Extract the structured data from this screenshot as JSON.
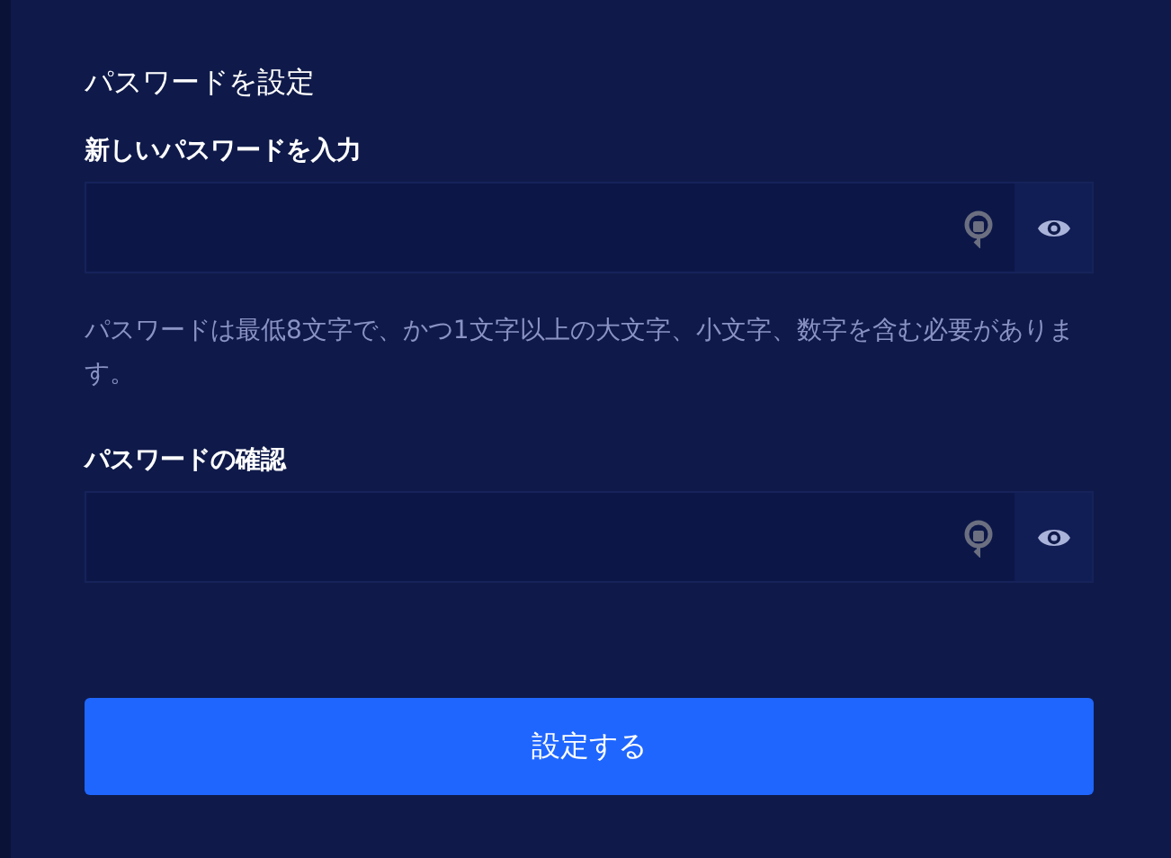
{
  "title": "パスワードを設定",
  "fields": [
    {
      "label": "新しいパスワードを入力",
      "hint": "パスワードは最低8文字で、かつ1文字以上の大文字、小文字、数字を含む必要があります。"
    },
    {
      "label": "パスワードの確認"
    }
  ],
  "submit": "設定する"
}
